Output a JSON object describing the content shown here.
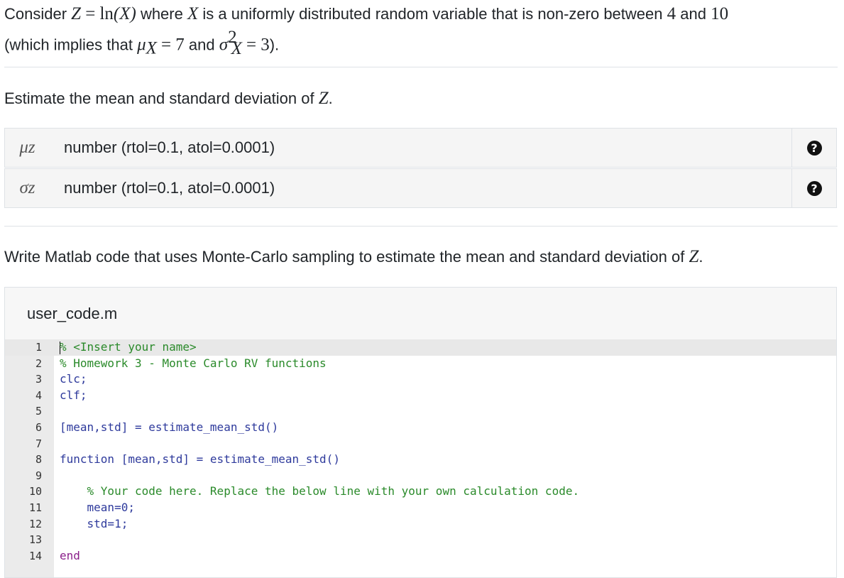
{
  "intro": {
    "text_consider": "Consider",
    "Z": "Z",
    "eq": "=",
    "ln": "ln",
    "X_arg": "(X)",
    "text_where": "where",
    "X": "X",
    "text_is": "is a uniformly distributed random variable that is non-zero between",
    "low": "4",
    "text_and": "and",
    "high": "10",
    "text_implies": "(which implies that",
    "mu": "μ",
    "sub_X": "X",
    "mu_val": "7",
    "text_and2": "and",
    "sigma": "σ",
    "sup_2": "2",
    "sigma_val": "3",
    "close": ")."
  },
  "question1": {
    "text": "Estimate the mean and standard deviation of",
    "var": "Z",
    "period": "."
  },
  "answers": [
    {
      "symbol": "μ",
      "sub": "z",
      "placeholder": "number (rtol=0.1, atol=0.0001)",
      "help": "?"
    },
    {
      "symbol": "σ",
      "sub": "z",
      "placeholder": "number (rtol=0.1, atol=0.0001)",
      "help": "?"
    }
  ],
  "question2": {
    "text": "Write Matlab code that uses Monte-Carlo sampling to estimate the mean and standard deviation of",
    "var": "Z",
    "period": "."
  },
  "editor": {
    "filename": "user_code.m",
    "line_numbers": [
      "1",
      "2",
      "3",
      "4",
      "5",
      "6",
      "7",
      "8",
      "9",
      "10",
      "11",
      "12",
      "13",
      "14"
    ],
    "lines": [
      "% <Insert your name>",
      "% Homework 3 - Monte Carlo RV functions",
      "clc;",
      "clf;",
      "",
      "[mean,std] = estimate_mean_std()",
      "",
      "function [mean,std] = estimate_mean_std()",
      "",
      "    % Your code here. Replace the below line with your own calculation code.",
      "    mean=0;",
      "    std=1;",
      "",
      "end"
    ]
  }
}
